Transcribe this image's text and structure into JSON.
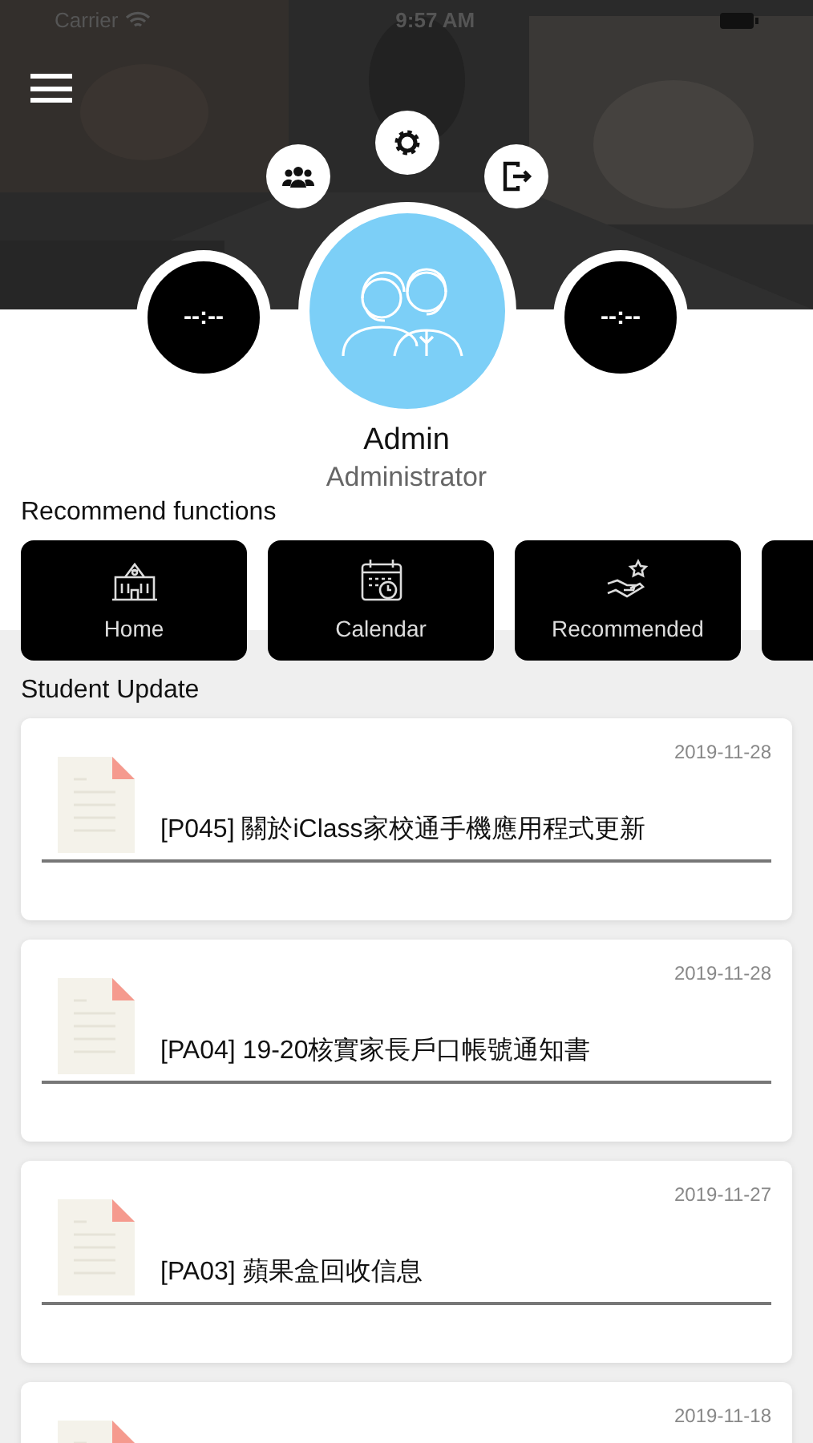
{
  "status_bar": {
    "carrier": "Carrier",
    "time": "9:57 AM"
  },
  "profile": {
    "name": "Admin",
    "role": "Administrator",
    "left_timer": "--:--",
    "right_timer": "--:--"
  },
  "recommend": {
    "title": "Recommend functions",
    "items": [
      {
        "label": "Home",
        "kind": "school"
      },
      {
        "label": "Calendar",
        "kind": "calendar"
      },
      {
        "label": "Recommended",
        "kind": "recommend"
      },
      {
        "kind": "partial"
      }
    ]
  },
  "updates": {
    "title": "Student Update",
    "items": [
      {
        "date": "2019-11-28",
        "title": "[P045] 關於iClass家校通手機應用程式更新"
      },
      {
        "date": "2019-11-28",
        "title": "[PA04] 19-20核實家長戶口帳號通知書"
      },
      {
        "date": "2019-11-27",
        "title": "[PA03] 蘋果盒回收信息"
      },
      {
        "date": "2019-11-18"
      }
    ]
  }
}
